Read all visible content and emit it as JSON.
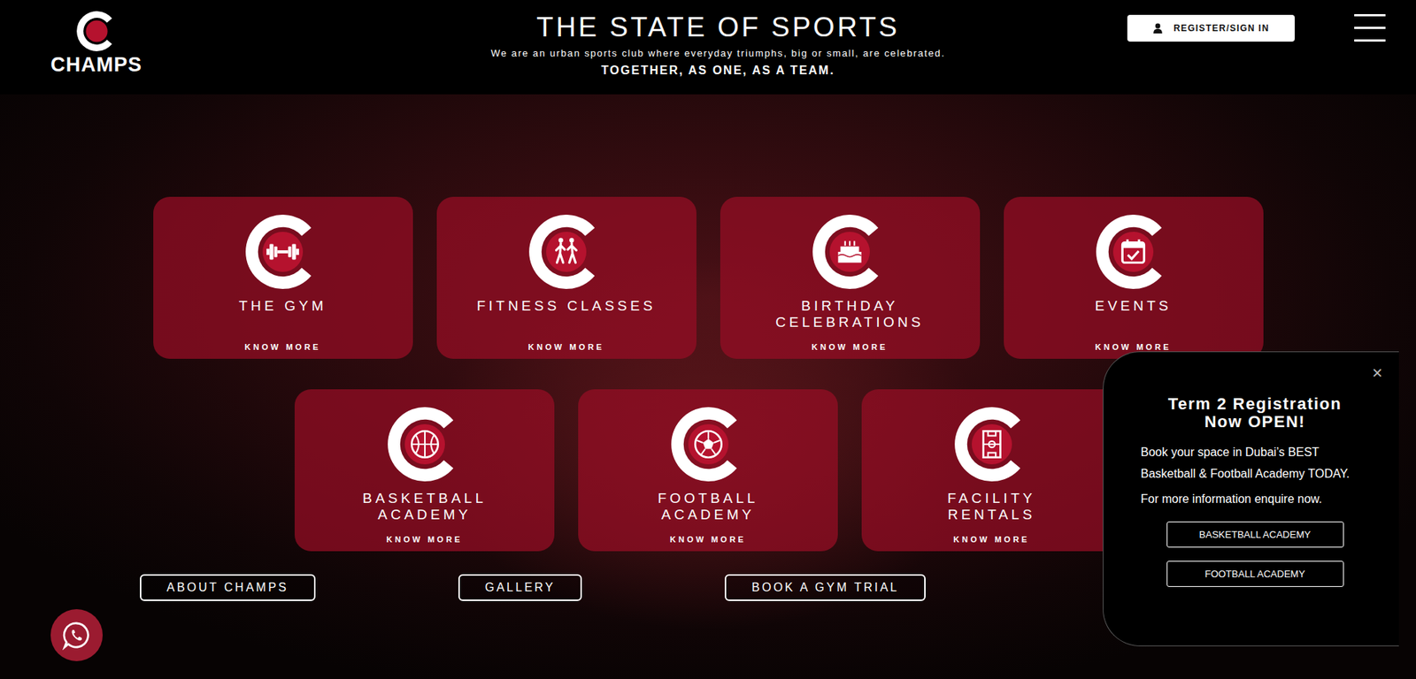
{
  "logo": {
    "text": "CHAMPS"
  },
  "header": {
    "title": "THE STATE OF SPORTS",
    "tagline": "We are an urban sports club where everyday triumphs, big or small, are celebrated.",
    "motto": "TOGETHER, AS ONE, AS A TEAM.",
    "auth_button": "REGISTER/SIGN IN"
  },
  "cards": [
    {
      "title_lines": [
        "THE GYM"
      ],
      "link": "KNOW MORE"
    },
    {
      "title_lines": [
        "FITNESS CLASSES"
      ],
      "link": "KNOW MORE"
    },
    {
      "title_lines": [
        "BIRTHDAY",
        "CELEBRATIONS"
      ],
      "link": "KNOW MORE"
    },
    {
      "title_lines": [
        "EVENTS"
      ],
      "link": "KNOW MORE"
    },
    {
      "title_lines": [
        "BASKETBALL",
        "ACADEMY"
      ],
      "link": "KNOW MORE"
    },
    {
      "title_lines": [
        "FOOTBALL",
        "ACADEMY"
      ],
      "link": "KNOW MORE"
    },
    {
      "title_lines": [
        "FACILITY",
        "RENTALS"
      ],
      "link": "KNOW MORE"
    }
  ],
  "actions": [
    "ABOUT CHAMPS",
    "GALLERY",
    "BOOK A GYM TRIAL"
  ],
  "popup": {
    "close": "×",
    "heading": "Term 2 Registration Now OPEN!",
    "body": "Book your space in Dubai’s BEST Basketball & Football Academy TODAY.",
    "note": "For more information enquire now.",
    "buttons": [
      "BASKETBALL ACADEMY",
      "FOOTBALL ACADEMY"
    ]
  }
}
